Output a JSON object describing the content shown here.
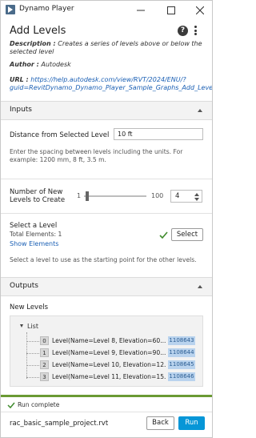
{
  "app": {
    "title": "Dynamo Player"
  },
  "header": {
    "title": "Add Levels",
    "description_label": "Description :",
    "description_text": "Creates a series of levels above or below the selected level",
    "author_label": "Author :",
    "author_value": "Autodesk",
    "url_label": "URL :",
    "url_line1": "https://help.autodesk.com/view/RVT/2024/ENU/?",
    "url_line2": "guid=RevitDynamo_Dynamo_Player_Sample_Graphs_Add_Level"
  },
  "inputs": {
    "section_label": "Inputs",
    "distance": {
      "label": "Distance from Selected Level",
      "value": "10 ft",
      "help": "Enter the spacing between levels including the units. For example: 1200 mm, 8 ft, 3.5 m."
    },
    "number": {
      "label_line1": "Number of New",
      "label_line2": "Levels to Create",
      "slider_min": "1",
      "slider_max": "100",
      "slider_fraction": 0.03,
      "value": "4"
    },
    "select_level": {
      "label": "Select a Level",
      "total_label": "Total Elements:",
      "total_value": "1",
      "show_elements": "Show Elements",
      "select_button": "Select",
      "help": "Select a level to use as the starting point for the other levels."
    }
  },
  "outputs": {
    "section_label": "Outputs",
    "new_levels_label": "New Levels",
    "list_label": "List",
    "items": [
      {
        "index": "0",
        "text": "Level(Name=Level 8, Elevation=60...",
        "id": "1108643"
      },
      {
        "index": "1",
        "text": "Level(Name=Level 9, Elevation=90...",
        "id": "1108644"
      },
      {
        "index": "2",
        "text": "Level(Name=Level 10, Elevation=12...",
        "id": "1108645"
      },
      {
        "index": "3",
        "text": "Level(Name=Level 11, Elevation=15...",
        "id": "1108646"
      }
    ]
  },
  "footer": {
    "status": "Run complete",
    "project": "rac_basic_sample_project.rvt",
    "back_button": "Back",
    "run_button": "Run"
  },
  "colors": {
    "accent": "#0696d7",
    "status_green": "#6a9a34",
    "link": "#1a5fb4",
    "id_highlight": "#b9d3ee"
  }
}
